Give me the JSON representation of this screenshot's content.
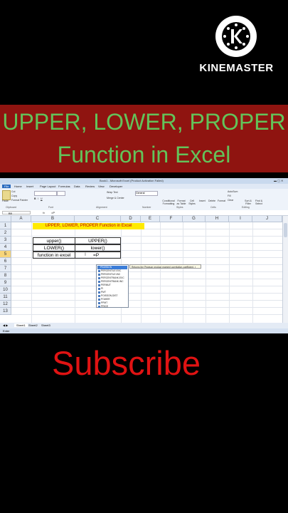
{
  "watermark": {
    "brand": "KINEMASTER",
    "icon": "kinemaster-k-icon"
  },
  "banner": {
    "line1": "UPPER, LOWER, PROPER",
    "line2": "Function in Excel",
    "bg_color": "#8f1410",
    "text_color": "#63c35a"
  },
  "excel": {
    "window_title": "Book1 - Microsoft Excel (Product Activation Failed)",
    "menu": [
      "File",
      "Home",
      "Insert",
      "Page Layout",
      "Formulas",
      "Data",
      "Review",
      "View",
      "Developer"
    ],
    "ribbon": {
      "clipboard": {
        "label": "Clipboard",
        "paste": "Paste",
        "cut": "Cut",
        "copy": "Copy",
        "format_painter": "Format Painter"
      },
      "font": {
        "label": "Font"
      },
      "alignment": {
        "label": "Alignment",
        "wrap": "Wrap Text",
        "merge": "Merge & Center"
      },
      "number": {
        "label": "Number",
        "format": "General"
      },
      "styles": {
        "label": "Styles",
        "conditional": "Conditional Formatting",
        "format_table": "Format as Table",
        "cell_styles": "Cell Styles"
      },
      "cells": {
        "label": "Cells",
        "insert": "Insert",
        "delete": "Delete",
        "format": "Format"
      },
      "editing": {
        "label": "Editing",
        "autosum": "AutoSum",
        "fill": "Fill",
        "clear": "Clear",
        "sort": "Sort & Filter",
        "find": "Find & Select"
      }
    },
    "name_box": "B5",
    "formula": "=P",
    "columns": [
      "A",
      "B",
      "C",
      "D",
      "E",
      "F",
      "G",
      "H",
      "I",
      "J"
    ],
    "rows": [
      "1",
      "2",
      "3",
      "4",
      "5",
      "6",
      "7",
      "8",
      "9",
      "10",
      "11",
      "12",
      "13"
    ],
    "cells": {
      "title": "UPPER, LOWER, PROPER Function in Excel",
      "b3": "upper()",
      "c3": "UPPER()",
      "b4": "LOWER()",
      "c4": "lower()",
      "b5": "function in excel",
      "c5": "=P"
    },
    "autocomplete": {
      "items": [
        "PEARSON",
        "PERCENTILE.EXC",
        "PERCENTILE.INC",
        "PERCENTRANK.EXC",
        "PERCENTRANK.INC",
        "PERMUT",
        "PI",
        "PMT",
        "POISSON.DIST",
        "POWER",
        "PPMT",
        "PRICE"
      ],
      "selected": 0,
      "tooltip": "Returns the Pearson product moment correlation coefficient, r"
    },
    "sheets": [
      "Sheet1",
      "Sheet2",
      "Sheet3"
    ],
    "status": "Enter"
  },
  "subscribe": {
    "label": "Subscribe",
    "color": "#e01313"
  }
}
